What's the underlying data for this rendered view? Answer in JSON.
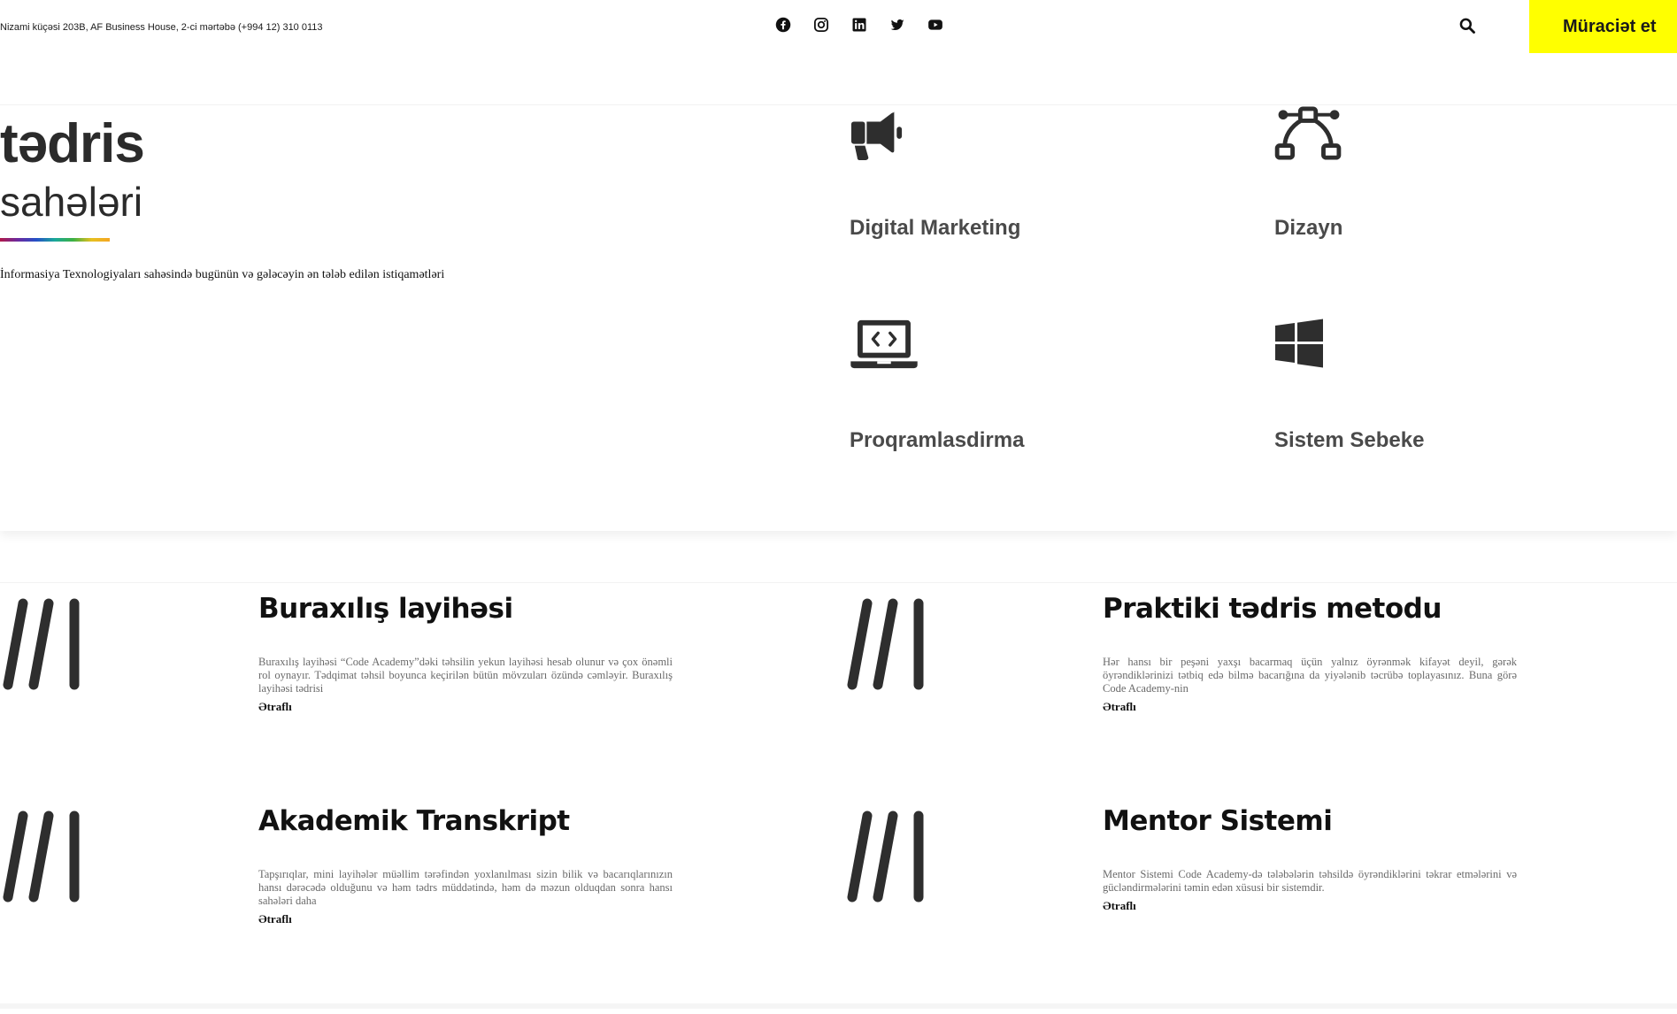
{
  "header": {
    "address": "Nizami küçəsi 203B, AF Business House, 2-ci mərtəbə (+994 12) 310 0113",
    "socials": [
      "facebook-icon",
      "instagram-icon",
      "linkedin-icon",
      "twitter-icon",
      "youtube-icon"
    ],
    "apply_label": "Müraciət et",
    "accent": "#ffff00"
  },
  "areas": {
    "heading_bold": "tədris",
    "heading_light": "sahələri",
    "subtitle": "İnformasiya Texnologiyaları sahəsində bugünün və gələcəyin ən tələb edilən istiqamətləri",
    "items": [
      {
        "label": "Digital Marketing",
        "icon": "megaphone-icon"
      },
      {
        "label": "Dizayn",
        "icon": "bezier-curve-icon"
      },
      {
        "label": "Proqramlasdirma",
        "icon": "laptop-code-icon"
      },
      {
        "label": "Sistem Sebeke",
        "icon": "windows-icon"
      }
    ]
  },
  "features": [
    {
      "title": "Buraxılış layihəsi",
      "text": "Buraxılış layihəsi “Code Academy”dəki təhsilin yekun layihəsi hesab olunur və çox önəmli rol oynayır. Tədqimat təhsil boyunca keçirilən bütün mövzuları özündə cəmləyir. Buraxılış layihəsi tədrisi",
      "link": "Ətraflı"
    },
    {
      "title": "Praktiki tədris metodu",
      "text": "Hər hansı bir peşəni yaxşı bacarmaq üçün yalnız öyrənmək kifayət deyil, gərək öyrəndiklərinizi tətbiq edə bilmə bacarığına da yiyələnib təcrübə toplayasınız. Buna görə Code Academy-nin",
      "link": "Ətraflı"
    },
    {
      "title": "Akademik Transkript",
      "text": "Tapşırıqlar, mini layihələr müəllim tərəfindən yoxlanılması sizin bilik və bacarıqlarınızın hansı dərəcədə olduğunu və həm tədrs müddətində, həm də məzun olduqdan sonra hansı sahələri daha",
      "link": "Ətraflı"
    },
    {
      "title": "Mentor Sistemi",
      "text": "Mentor Sistemi Code Academy-də tələbələrin təhsildə öyrəndiklərini təkrar etmələrini və gücləndirmələrini təmin edən xüsusi bir sistemdir.",
      "link": "Ətraflı"
    }
  ]
}
